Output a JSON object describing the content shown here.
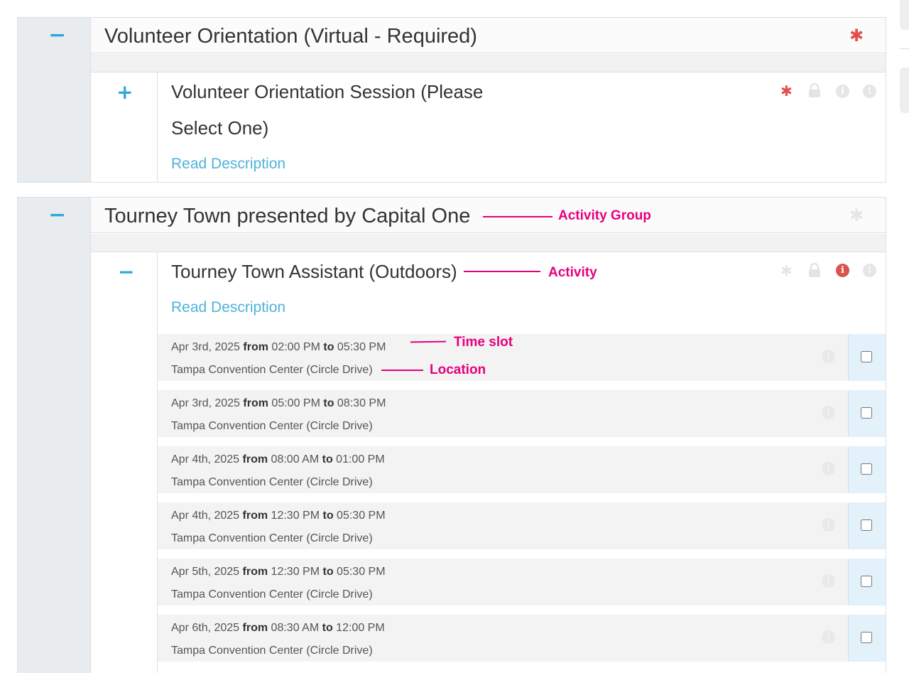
{
  "groups": [
    {
      "title": "Volunteer Orientation (Virtual - Required)",
      "toggle": "−",
      "activity": {
        "toggle": "+",
        "title_line1": "Volunteer Orientation Session (Please",
        "title_line2": "Select One)",
        "read_description": "Read Description"
      }
    },
    {
      "title": "Tourney Town presented by Capital One",
      "toggle": "−",
      "activity": {
        "toggle": "−",
        "title_line1": "Tourney Town Assistant (Outdoors)",
        "read_description": "Read Description",
        "slots": [
          {
            "date": "Apr 3rd, 2025",
            "from_word": "from",
            "start": "02:00 PM",
            "to_word": "to",
            "end": "05:30 PM",
            "location": "Tampa Convention Center (Circle Drive)",
            "checked": false
          },
          {
            "date": "Apr 3rd, 2025",
            "from_word": "from",
            "start": "05:00 PM",
            "to_word": "to",
            "end": "08:30 PM",
            "location": "Tampa Convention Center (Circle Drive)",
            "checked": false
          },
          {
            "date": "Apr 4th, 2025",
            "from_word": "from",
            "start": "08:00 AM",
            "to_word": "to",
            "end": "01:00 PM",
            "location": "Tampa Convention Center (Circle Drive)",
            "checked": false
          },
          {
            "date": "Apr 4th, 2025",
            "from_word": "from",
            "start": "12:30 PM",
            "to_word": "to",
            "end": "05:30 PM",
            "location": "Tampa Convention Center (Circle Drive)",
            "checked": false
          },
          {
            "date": "Apr 5th, 2025",
            "from_word": "from",
            "start": "12:30 PM",
            "to_word": "to",
            "end": "05:30 PM",
            "location": "Tampa Convention Center (Circle Drive)",
            "checked": false
          },
          {
            "date": "Apr 6th, 2025",
            "from_word": "from",
            "start": "08:30 AM",
            "to_word": "to",
            "end": "12:00 PM",
            "location": "Tampa Convention Center (Circle Drive)",
            "checked": false
          }
        ]
      }
    }
  ],
  "annotations": {
    "activity_group": "Activity Group",
    "activity": "Activity",
    "time_slot": "Time slot",
    "location": "Location"
  },
  "icons": {
    "required": "asterisk-icon",
    "locked": "lock-icon",
    "info": "info-icon",
    "warning": "exclamation-icon"
  },
  "colors": {
    "accent": "#2fa8d8",
    "link": "#4fb3d9",
    "required_active": "#e44d4d",
    "info_active": "#d9534f",
    "icon_inactive": "#e6e6e6",
    "annotation": "#e6007e",
    "slot_check_bg": "#e3f1fa"
  }
}
